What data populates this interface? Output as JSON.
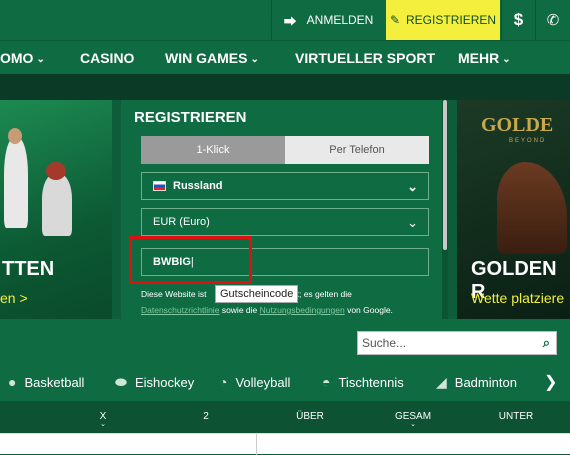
{
  "header": {
    "login_label": "ANMELDEN",
    "register_label": "REGISTRIEREN",
    "currency_symbol": "$",
    "phone_icon": "phone-icon"
  },
  "nav": {
    "items": [
      {
        "label": "OMO",
        "has_dropdown": true
      },
      {
        "label": "CASINO",
        "has_dropdown": false
      },
      {
        "label": "WIN GAMES",
        "has_dropdown": true
      },
      {
        "label": "VIRTUELLER SPORT",
        "has_dropdown": false
      },
      {
        "label": "MEHR",
        "has_dropdown": true
      }
    ]
  },
  "banners": {
    "left": {
      "title": "TTEN",
      "link": "en >"
    },
    "right": {
      "logo_text": "GOLDE",
      "logo_sub": "BEYOND",
      "title": "GOLDEN R",
      "link": "Wette platziere"
    }
  },
  "registration": {
    "title": "REGISTRIEREN",
    "tabs": [
      "1-Klick",
      "Per Telefon"
    ],
    "active_tab": "1-Klick",
    "country": "Russland",
    "currency": "EUR (Euro)",
    "promo_code": "BWBIG",
    "promo_tooltip": "Gutscheincode",
    "disclaimer_prefix": "Diese Website ist",
    "disclaimer_mid": "ützt; es gelten die",
    "privacy_link": "Datenschutzrichtlinie",
    "disclaimer_and": "sowie die",
    "terms_link": "Nutzungsbedingungen",
    "disclaimer_suffix": "von Google."
  },
  "search": {
    "placeholder": "Suche..."
  },
  "sports": [
    {
      "label": "Basketball",
      "icon": "basketball-icon"
    },
    {
      "label": "Eishockey",
      "icon": "hockey-puck-icon"
    },
    {
      "label": "Volleyball",
      "icon": "volleyball-icon"
    },
    {
      "label": "Tischtennis",
      "icon": "table-tennis-icon"
    },
    {
      "label": "Badminton",
      "icon": "shuttlecock-icon"
    }
  ],
  "columns": [
    "X",
    "2",
    "ÜBER",
    "GESAM",
    "UNTER"
  ],
  "colors": {
    "brand_green": "#0f6b42",
    "accent_yellow": "#f3ef3c",
    "highlight_red": "#e01010"
  }
}
